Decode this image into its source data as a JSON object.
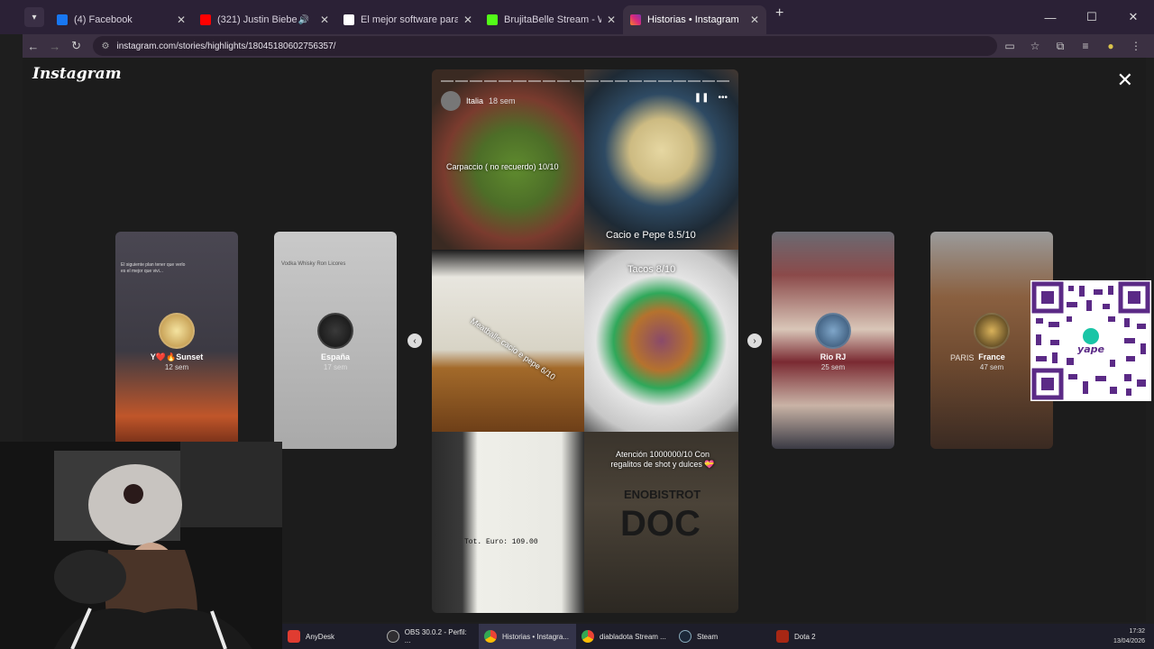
{
  "browser": {
    "tabs": [
      {
        "title": "(4) Facebook",
        "favicon_color": "#1877f2",
        "muted": false,
        "active": false
      },
      {
        "title": "(321) Justin Bieber - Never",
        "favicon_color": "#ff0000",
        "muted": true,
        "active": false
      },
      {
        "title": "El mejor software para potenci",
        "favicon_color": "#ffffff",
        "muted": false,
        "active": false
      },
      {
        "title": "BrujitaBelle Stream - Watch Liv",
        "favicon_color": "#53fc18",
        "muted": false,
        "active": false
      },
      {
        "title": "Historias • Instagram",
        "favicon_color": "#e1306c",
        "muted": false,
        "active": true
      }
    ],
    "url": "instagram.com/stories/highlights/18045180602756357/"
  },
  "instagram": {
    "logo": "Instagram",
    "left_cards": [
      {
        "name": "Y❤️🔥Sunset",
        "age": "12 sem",
        "text": "El siguiente plan tener que verlo es el mejor que vivi..."
      },
      {
        "name": "España",
        "age": "17 sem",
        "text": "Vodka  Whisky  Ron  Licores"
      }
    ],
    "right_cards": [
      {
        "name": "Rio RJ",
        "age": "25 sem"
      },
      {
        "name": "France",
        "age": "47 sem",
        "text": "PARIS"
      }
    ],
    "story": {
      "user": "Italia",
      "age": "18 sem",
      "captions": {
        "carpaccio": "Carpaccio ( no recuerdo) 10/10",
        "cacio": "Cacio e Pepe 8.5/10",
        "meatballs": "Meatballs cacio e pepe 6/10",
        "tacos": "Tacos 8/10",
        "receipt_total": "Tot. Euro:     109.00",
        "attention": "Atención 1000000/10 Con regalitos de shot y dulces 💝",
        "brand": "ENOBISTROT",
        "brand_big": "DOC"
      }
    }
  },
  "taskbar": {
    "items": [
      {
        "label": "AnyDesk",
        "color": "#e03c31"
      },
      {
        "label": "OBS 30.0.2 - Perfil: ...",
        "color": "#302e31"
      },
      {
        "label": "Historias • Instagra...",
        "color": "#4285f4",
        "active": true
      },
      {
        "label": "diabladota Stream ...",
        "color": "#4285f4"
      },
      {
        "label": "Steam",
        "color": "#1b2838"
      },
      {
        "label": "Dota 2",
        "color": "#a72714"
      }
    ],
    "time": "17:32",
    "date": "13/04/2026"
  },
  "icons": [
    "tab-list-icon",
    "back-icon",
    "forward-icon",
    "reload-icon",
    "site-info-icon",
    "cast-icon",
    "star-icon",
    "extensions-icon",
    "media-icon",
    "profile-icon",
    "menu-icon",
    "close-icon",
    "pause-icon",
    "more-icon",
    "prev-arrow-icon",
    "next-arrow-icon"
  ]
}
